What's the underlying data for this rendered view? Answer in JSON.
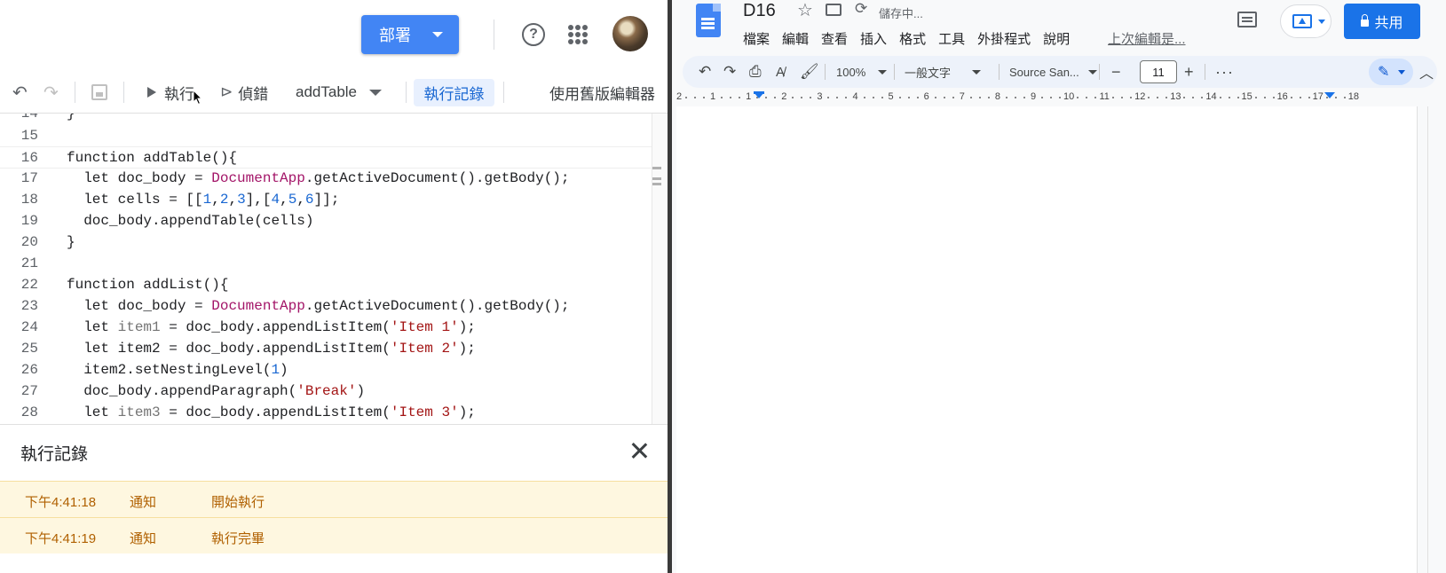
{
  "script_editor": {
    "deploy_label": "部署",
    "toolbar": {
      "run_label": "執行",
      "debug_label": "偵錯",
      "function_name": "addTable",
      "execution_log_label": "執行記錄",
      "legacy_editor_label": "使用舊版編輯器"
    },
    "code_lines": [
      {
        "num": "15",
        "text": ""
      },
      {
        "num": "16",
        "text": "function addTable(){"
      },
      {
        "num": "17",
        "text": "  let doc_body = DocumentApp.getActiveDocument().getBody();"
      },
      {
        "num": "18",
        "text": "  let cells = [[1,2,3],[4,5,6]];"
      },
      {
        "num": "19",
        "text": "  doc_body.appendTable(cells)"
      },
      {
        "num": "20",
        "text": "}"
      },
      {
        "num": "21",
        "text": ""
      },
      {
        "num": "22",
        "text": "function addList(){"
      },
      {
        "num": "23",
        "text": "  let doc_body = DocumentApp.getActiveDocument().getBody();"
      },
      {
        "num": "24",
        "text": "  let item1 = doc_body.appendListItem('Item 1');"
      },
      {
        "num": "25",
        "text": "  let item2 = doc_body.appendListItem('Item 2');"
      },
      {
        "num": "26",
        "text": "  item2.setNestingLevel(1)"
      },
      {
        "num": "27",
        "text": "  doc_body.appendParagraph('Break')"
      },
      {
        "num": "28",
        "text": "  let item3 = doc_body.appendListItem('Item 3');"
      }
    ],
    "log_panel": {
      "title": "執行記錄",
      "entries": [
        {
          "time": "下午4:41:18",
          "level": "通知",
          "message": "開始執行"
        },
        {
          "time": "下午4:41:19",
          "level": "通知",
          "message": "執行完畢"
        }
      ]
    }
  },
  "docs": {
    "title": "D16",
    "save_status": "儲存中...",
    "menu": [
      "檔案",
      "編輯",
      "查看",
      "插入",
      "格式",
      "工具",
      "外掛程式",
      "說明"
    ],
    "last_edit": "上次編輯是...",
    "share_label": "共用",
    "toolbar": {
      "zoom": "100%",
      "style": "一般文字",
      "font": "Source San...",
      "font_size": "11"
    },
    "ruler": [
      "2",
      "1",
      "1",
      "2",
      "3",
      "4",
      "5",
      "6",
      "7",
      "8",
      "9",
      "10",
      "11",
      "12",
      "13",
      "14",
      "15",
      "16",
      "17",
      "18"
    ]
  },
  "colors": {
    "accent_blue": "#4285f4",
    "share_blue": "#1a73e8",
    "log_bg": "#fef7e0",
    "log_text": "#b06000"
  }
}
